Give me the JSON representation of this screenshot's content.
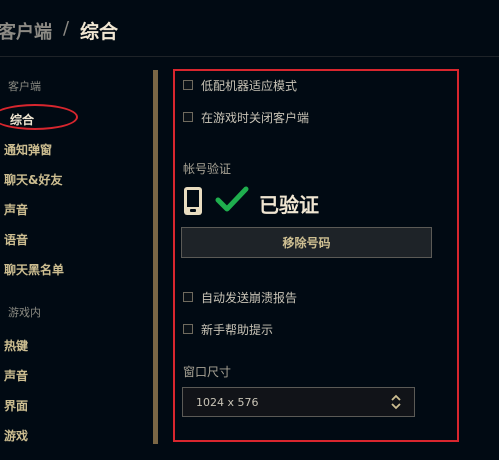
{
  "header": {
    "parent": "客户端",
    "separator": "/",
    "current": "综合"
  },
  "sidebar": {
    "section_client": "客户端",
    "client_items": [
      "综合",
      "通知弹窗",
      "聊天&好友",
      "声音",
      "语音",
      "聊天黑名单"
    ],
    "section_ingame": "游戏内",
    "ingame_items": [
      "热键",
      "声音",
      "界面",
      "游戏"
    ]
  },
  "settings": {
    "low_spec_mode": {
      "label": "低配机器适应模式",
      "checked": false
    },
    "close_client_in_game": {
      "label": "在游戏时关闭客户端",
      "checked": false
    },
    "account_verification": {
      "label": "帐号验证",
      "status": "已验证",
      "remove_button": "移除号码"
    },
    "auto_crash_report": {
      "label": "自动发送崩溃报告",
      "checked": false
    },
    "newbie_tips": {
      "label": "新手帮助提示",
      "checked": false
    },
    "window_size": {
      "label": "窗口尺寸",
      "value": "1024 x 576"
    }
  },
  "colors": {
    "background": "#010a13",
    "gold_text": "#cdbe91",
    "verified_check": "#1fae4e",
    "annotation_red": "#d8262e"
  },
  "icons": [
    "phone-icon",
    "checkmark-icon",
    "select-arrows-icon"
  ]
}
